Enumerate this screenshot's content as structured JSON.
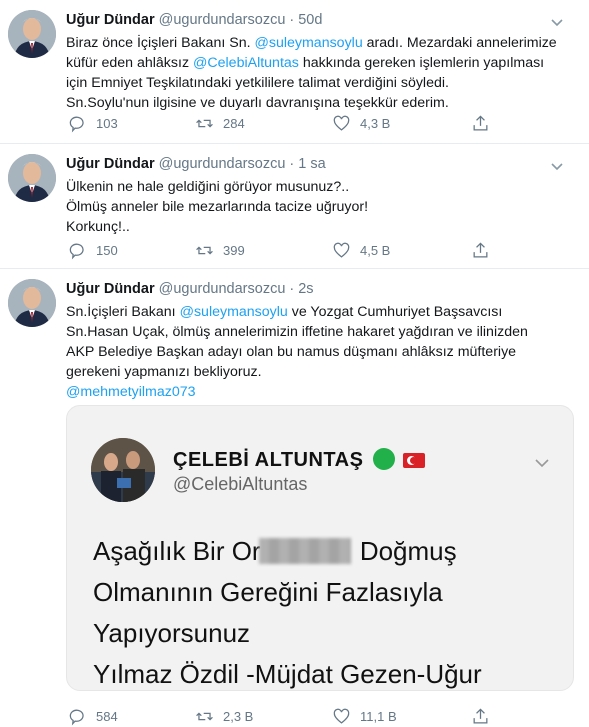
{
  "tweets": [
    {
      "author_name": "Uğur Dündar",
      "handle": "@ugurdundarsozcu",
      "time": "50d",
      "text_lines": [
        [
          {
            "t": "Biraz önce İçişleri Bakanı Sn. "
          },
          {
            "t": "@suleymansoylu",
            "m": true
          },
          {
            "t": " aradı. Mezardaki annelerimize"
          }
        ],
        [
          {
            "t": "küfür eden ahlâksız "
          },
          {
            "t": "@CelebiAltuntas",
            "m": true
          },
          {
            "t": " hakkında gereken işlemlerin yapılması"
          }
        ],
        [
          {
            "t": "için Emniyet Teşkilatındaki yetkililere talimat verdiğini söyledi."
          }
        ],
        [
          {
            "t": "Sn.Soylu'nun ilgisine ve duyarlı davranışına teşekkür ederim."
          }
        ]
      ],
      "replies": "103",
      "retweets": "284",
      "likes": "4,3 B"
    },
    {
      "author_name": "Uğur Dündar",
      "handle": "@ugurdundarsozcu",
      "time": "1 sa",
      "text_lines": [
        [
          {
            "t": "Ülkenin ne hale geldiğini görüyor musunuz?.."
          }
        ],
        [
          {
            "t": "Ölmüş anneler bile mezarlarında tacize uğruyor!"
          }
        ],
        [
          {
            "t": "Korkunç!.."
          }
        ]
      ],
      "replies": "150",
      "retweets": "399",
      "likes": "4,5 B"
    },
    {
      "author_name": "Uğur Dündar",
      "handle": "@ugurdundarsozcu",
      "time": "2s",
      "text_lines": [
        [
          {
            "t": "Sn.İçişleri Bakanı "
          },
          {
            "t": "@suleymansoylu",
            "m": true
          },
          {
            "t": "  ve Yozgat Cumhuriyet Başsavcısı"
          }
        ],
        [
          {
            "t": "Sn.Hasan Uçak, ölmüş annelerimizin iffetine hakaret yağdıran ve ilinizden"
          }
        ],
        [
          {
            "t": "AKP Belediye Başkan adayı olan bu namus düşmanı ahlâksız müfteriye"
          }
        ],
        [
          {
            "t": "gerekeni yapmanızı bekliyoruz."
          }
        ],
        [
          {
            "t": "@mehmetyilmaz073",
            "m": true
          }
        ]
      ],
      "embed": {
        "name": "ÇELEBİ ALTUNTAŞ",
        "handle": "@CelebiAltuntas",
        "line1_before": "Aşağılık Bir Or",
        "line1_after": " Doğmuş",
        "line2": "Olmanının Gereğini Fazlasıyla",
        "line3": "Yapıyorsunuz",
        "line4": "Yılmaz Özdil -Müjdat Gezen-Uğur"
      },
      "replies": "584",
      "retweets": "2,3 B",
      "likes": "11,1 B"
    }
  ],
  "icons": {
    "reply": "reply-icon",
    "retweet": "retweet-icon",
    "like": "heart-icon",
    "share": "share-icon",
    "more": "chevron-down-icon"
  },
  "colors": {
    "link": "#1da1f2",
    "muted": "#657786",
    "divider": "#e6ecf0"
  }
}
